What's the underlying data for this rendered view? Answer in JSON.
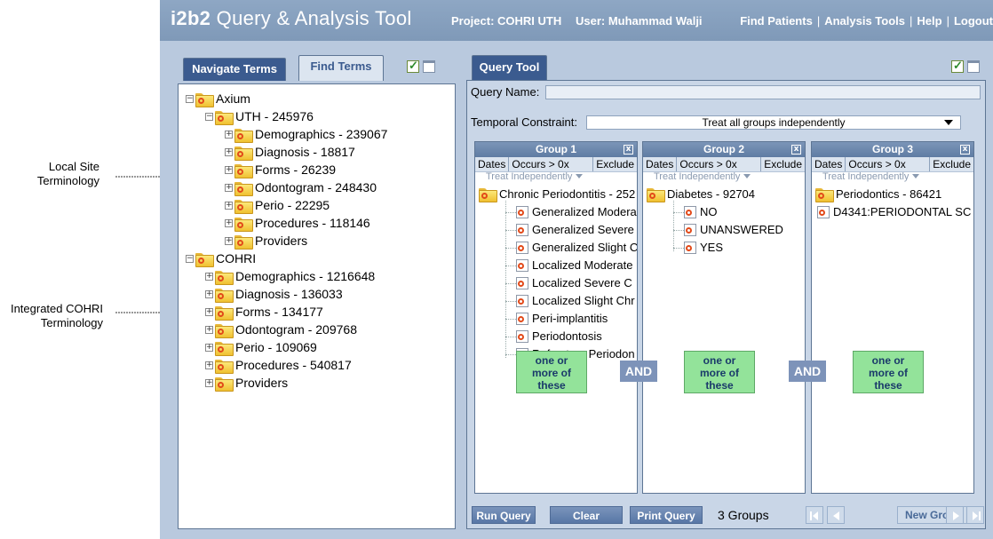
{
  "annotations": {
    "local_site": [
      "Local Site",
      "Terminology"
    ],
    "integrated": [
      "Integrated COHRI",
      "Terminology"
    ]
  },
  "header": {
    "logo": "i2b2",
    "title": "Query & Analysis Tool",
    "project": "Project: COHRI UTH",
    "user": "User: Muhammad Walji",
    "links": [
      "Find Patients",
      "Analysis Tools",
      "Help",
      "Logout"
    ]
  },
  "left": {
    "tabs": [
      "Navigate Terms",
      "Find Terms"
    ],
    "tree": [
      {
        "label": "Axium",
        "level": 0,
        "exp": "-"
      },
      {
        "label": "UTH - 245976",
        "level": 1,
        "exp": "-"
      },
      {
        "label": "Demographics - 239067",
        "level": 2,
        "exp": "+"
      },
      {
        "label": "Diagnosis - 18817",
        "level": 2,
        "exp": "+"
      },
      {
        "label": "Forms - 26239",
        "level": 2,
        "exp": "+"
      },
      {
        "label": "Odontogram - 248430",
        "level": 2,
        "exp": "+"
      },
      {
        "label": "Perio - 22295",
        "level": 2,
        "exp": "+"
      },
      {
        "label": "Procedures - 118146",
        "level": 2,
        "exp": "+"
      },
      {
        "label": "Providers",
        "level": 2,
        "exp": "+"
      },
      {
        "label": "COHRI",
        "level": 0,
        "exp": "-"
      },
      {
        "label": "Demographics - 1216648",
        "level": 1,
        "exp": "+"
      },
      {
        "label": "Diagnosis - 136033",
        "level": 1,
        "exp": "+"
      },
      {
        "label": "Forms - 134177",
        "level": 1,
        "exp": "+"
      },
      {
        "label": "Odontogram - 209768",
        "level": 1,
        "exp": "+"
      },
      {
        "label": "Perio - 109069",
        "level": 1,
        "exp": "+"
      },
      {
        "label": "Procedures - 540817",
        "level": 1,
        "exp": "+"
      },
      {
        "label": "Providers",
        "level": 1,
        "exp": "+"
      }
    ]
  },
  "query_tool": {
    "tab": "Query Tool",
    "query_name_label": "Query Name:",
    "temporal_label": "Temporal Constraint:",
    "temporal_value": "Treat all groups independently",
    "group_options": [
      "Dates",
      "Occurs > 0x",
      "Exclude"
    ],
    "treat": "Treat Independently",
    "one_or_more": [
      "one or",
      "more of",
      "these"
    ],
    "and": "AND",
    "groups": [
      {
        "title": "Group 1",
        "items": [
          {
            "label": "Chronic Periodontitis - 252",
            "type": "folder"
          },
          {
            "label": "Generalized Modera",
            "type": "leaf"
          },
          {
            "label": "Generalized Severe",
            "type": "leaf"
          },
          {
            "label": "Generalized Slight C",
            "type": "leaf"
          },
          {
            "label": "Localized Moderate",
            "type": "leaf"
          },
          {
            "label": "Localized Severe C",
            "type": "leaf"
          },
          {
            "label": "Localized Slight Chr",
            "type": "leaf"
          },
          {
            "label": "Peri-implantitis",
            "type": "leaf"
          },
          {
            "label": "Periodontosis",
            "type": "leaf"
          },
          {
            "label": "Refractory Periodon",
            "type": "leaf"
          }
        ]
      },
      {
        "title": "Group 2",
        "items": [
          {
            "label": "Diabetes - 92704",
            "type": "folder"
          },
          {
            "label": "NO",
            "type": "leaf"
          },
          {
            "label": "UNANSWERED",
            "type": "leaf"
          },
          {
            "label": "YES",
            "type": "leaf"
          }
        ]
      },
      {
        "title": "Group 3",
        "items": [
          {
            "label": "Periodontics - 86421",
            "type": "folder"
          },
          {
            "label": "D4341:PERIODONTAL SC",
            "type": "leaf-root"
          }
        ]
      }
    ],
    "buttons": {
      "run": "Run Query",
      "clear": "Clear",
      "print": "Print Query",
      "new_group": "New Group"
    },
    "groups_count": "3 Groups"
  }
}
